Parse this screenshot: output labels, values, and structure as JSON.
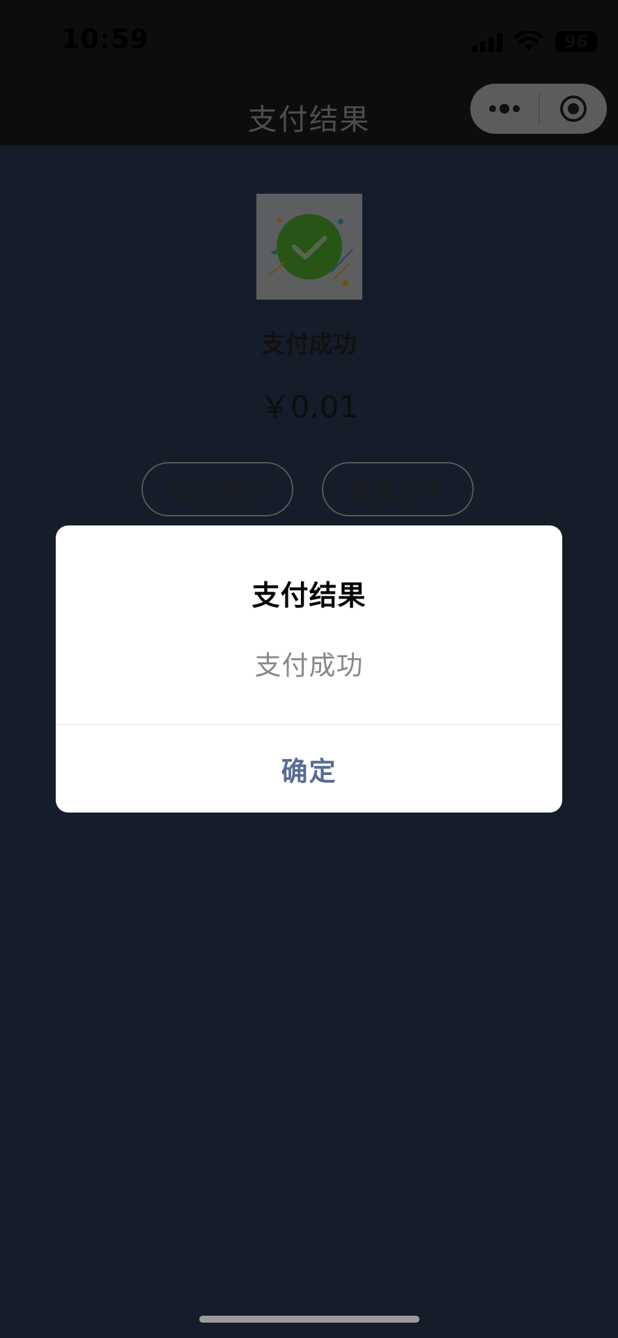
{
  "status_bar": {
    "time": "10:59",
    "battery": "96"
  },
  "nav": {
    "title": "支付结果"
  },
  "page": {
    "result_title": "支付成功",
    "amount": "￥0.01",
    "buttons": {
      "home": "返回首页",
      "orders": "查看订单"
    }
  },
  "dialog": {
    "title": "支付结果",
    "message": "支付成功",
    "confirm": "确定"
  },
  "colors": {
    "page_bg": "#2b3a55",
    "nav_bg": "#1b1b1b",
    "success_green": "#4caa2a",
    "dialog_confirm": "#576b95"
  }
}
